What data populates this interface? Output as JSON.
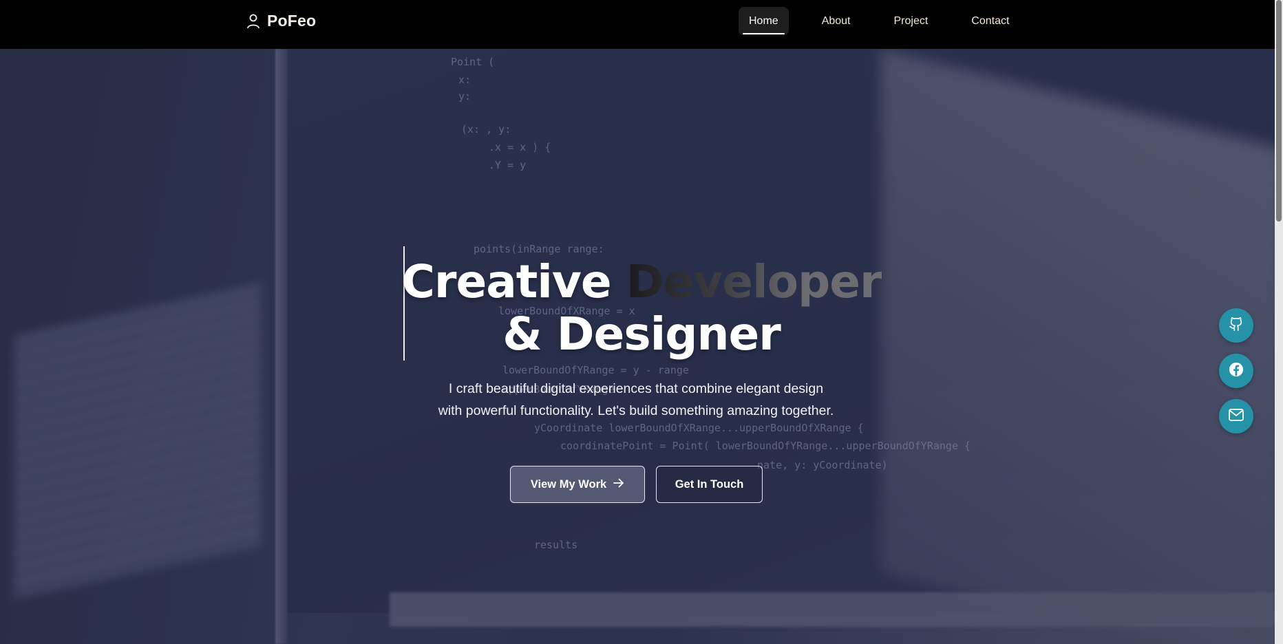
{
  "brand": {
    "name": "PoFeo",
    "icon": "user-icon"
  },
  "nav": {
    "items": [
      {
        "label": "Home",
        "active": true
      },
      {
        "label": "About",
        "active": false
      },
      {
        "label": "Project",
        "active": false
      },
      {
        "label": "Contact",
        "active": false
      }
    ]
  },
  "hero": {
    "headline_word1": "Creative",
    "headline_word2": "Developer",
    "headline_line2": "& Designer",
    "description": "I craft beautiful digital experiences that combine elegant design with powerful functionality. Let's build something amazing together.",
    "primary_button": "View My Work",
    "primary_button_icon": "arrow-right-icon",
    "secondary_button": "Get In Touch"
  },
  "social": [
    {
      "name": "github",
      "icon": "github-icon"
    },
    {
      "name": "facebook",
      "icon": "facebook-icon"
    },
    {
      "name": "mail",
      "icon": "mail-icon"
    }
  ],
  "background_code": [
    "Point (",
    "x:",
    "y:",
    "(x:          , y:",
    ".x = x          ) {",
    ".Y = y",
    "points(inRange range:",
    "lowerBoundOfXRange = x",
    "lowerBoundOfYRange = y - range",
    "upperBoundOfYRange",
    "yCoordinate     lowerBoundOfXRange...upperBoundOfXRange {",
    "coordinatePoint = Point(  lowerBoundOfYRange...upperBoundOfYRange {",
    "nate, y: yCoordinate)",
    "results"
  ],
  "colors": {
    "accent_social": "#2592a8",
    "nav_bg": "#000000",
    "nav_text": "#f3ead8"
  }
}
